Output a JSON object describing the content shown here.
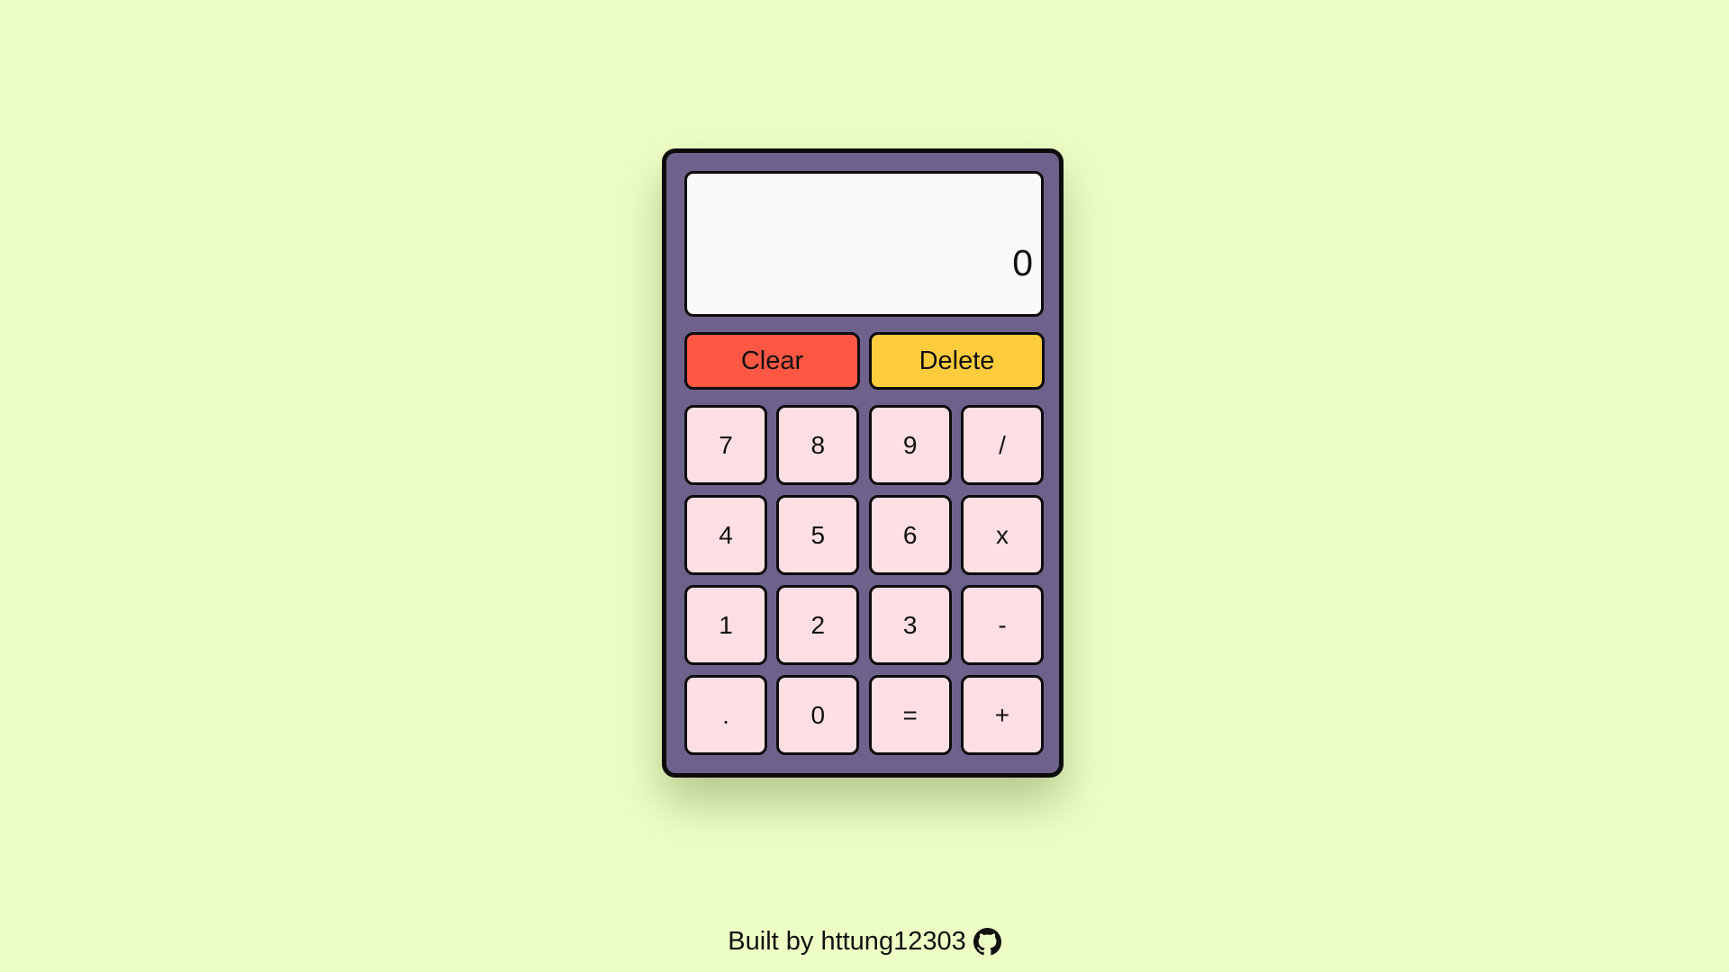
{
  "display": {
    "value": "0"
  },
  "controls": {
    "clear_label": "Clear",
    "delete_label": "Delete"
  },
  "keypad": {
    "keys": [
      "7",
      "8",
      "9",
      "/",
      "4",
      "5",
      "6",
      "x",
      "1",
      "2",
      "3",
      "-",
      ".",
      "0",
      "=",
      "+"
    ]
  },
  "footer": {
    "text": "Built by httung12303",
    "icon": "github-icon"
  },
  "colors": {
    "background": "#edfec5",
    "calculator_body": "#6e628c",
    "display_bg": "#f9f9f9",
    "clear_button": "#ff5744",
    "delete_button": "#ffcc3e",
    "key_bg": "#ffdfe4",
    "border": "#0c0c0c"
  }
}
